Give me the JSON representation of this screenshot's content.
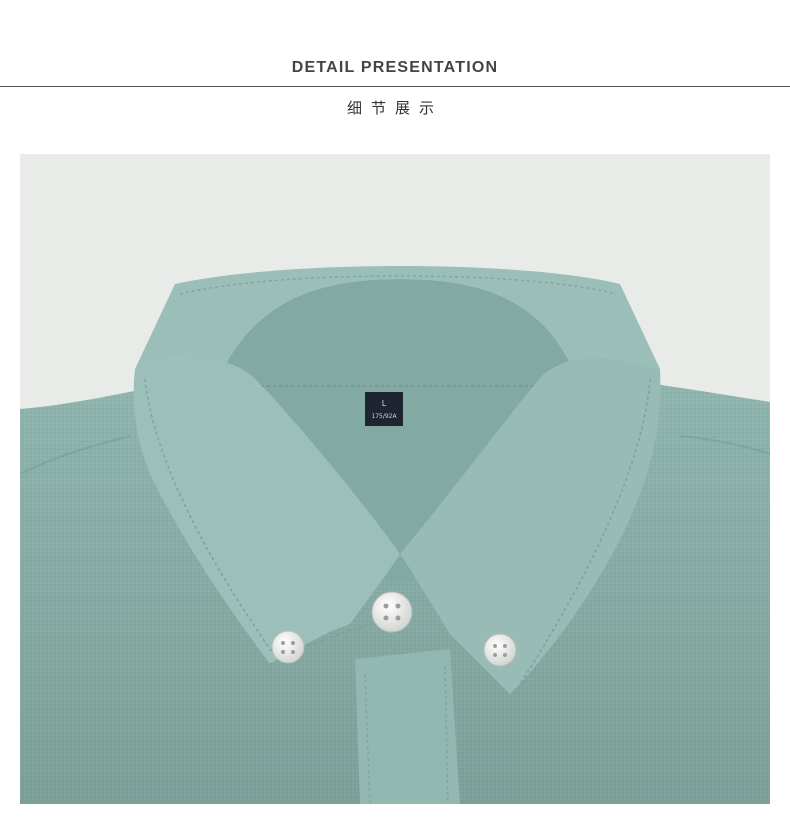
{
  "header": {
    "title": "DETAIL PRESENTATION",
    "subtitle": "细节展示"
  },
  "photo": {
    "subject": "shirt-collar-photo",
    "label_text": "L",
    "label_subtext": "175/92A",
    "colors": {
      "background": "#e9ebe8",
      "shirt": "#8fb5ae",
      "shirt_dark": "#769e97",
      "shirt_light": "#a6c6c0",
      "label": "#1e2430",
      "button": "#ecece9"
    }
  }
}
